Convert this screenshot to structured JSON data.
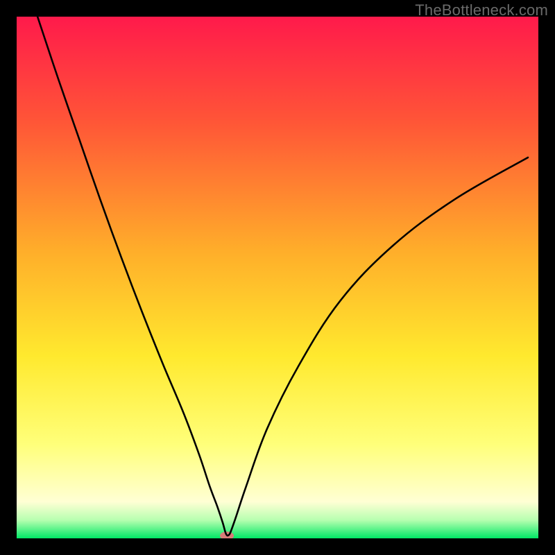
{
  "watermark": "TheBottleneck.com",
  "chart_data": {
    "type": "line",
    "title": "",
    "xlabel": "",
    "ylabel": "",
    "xlim": [
      0,
      100
    ],
    "ylim": [
      0,
      100
    ],
    "grid": false,
    "legend": false,
    "gradient_stops": [
      {
        "offset": 0.0,
        "color": "#ff1a4b"
      },
      {
        "offset": 0.2,
        "color": "#ff5537"
      },
      {
        "offset": 0.45,
        "color": "#ffae2a"
      },
      {
        "offset": 0.65,
        "color": "#ffe92e"
      },
      {
        "offset": 0.82,
        "color": "#ffff7a"
      },
      {
        "offset": 0.93,
        "color": "#ffffd4"
      },
      {
        "offset": 0.965,
        "color": "#b7ffb0"
      },
      {
        "offset": 1.0,
        "color": "#00e865"
      }
    ],
    "series": [
      {
        "name": "bottleneck-curve",
        "color": "#000000",
        "x": [
          4,
          8,
          12,
          16,
          20,
          24,
          28,
          32,
          35,
          37,
          38.5,
          39.5,
          40,
          40.3,
          40.6,
          41,
          42,
          44,
          48,
          54,
          62,
          72,
          84,
          98
        ],
        "y": [
          100,
          88,
          76.5,
          65,
          54,
          43.5,
          33.5,
          24,
          16,
          10,
          6,
          3,
          1.2,
          0.6,
          0.6,
          1.2,
          4,
          10,
          21,
          33,
          45.5,
          56,
          65,
          73
        ]
      }
    ],
    "marker": {
      "name": "optimal-point",
      "x": 40.3,
      "y": 0.5,
      "color": "#d97b78",
      "rx": 10,
      "ry": 6
    }
  }
}
